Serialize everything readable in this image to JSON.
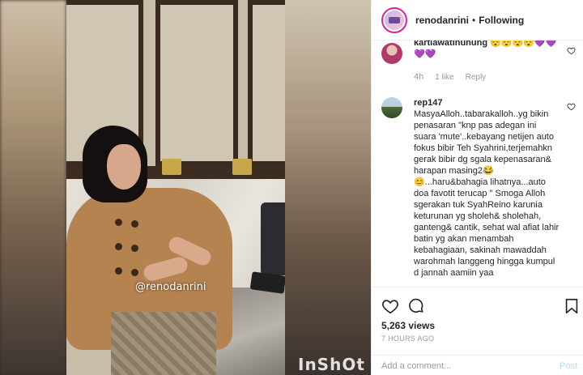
{
  "post": {
    "username": "renodanrini",
    "separator": "•",
    "follow_status": "Following",
    "video_watermark": "@renodanrini",
    "video_logo": "InShOt"
  },
  "comments": [
    {
      "username": "kartiawatinunung",
      "text": "😴😴😴😴💜💜💜💜",
      "time": "4h",
      "likes": "1 like",
      "reply_label": "Reply"
    },
    {
      "username": "rep147",
      "text": "MasyaAlloh..tabarakalloh..yg bikin penasaran \"knp pas adegan ini suara 'mute'..kebayang netijen auto fokus bibir Teh Syahrini,terjemahkn gerak bibir dg sgala kepenasaran& harapan masing2😂😊...haru&bahagia lihatnya...auto doa favotit terucap \" Smoga Alloh sgerakan tuk SyahReino karunia keturunan yg sholeh& sholehah, ganteng& cantik, sehat wal afiat lahir batin yg akan menambah kebahagiaan, sakinah mawaddah warohmah langgeng hingga kumpul d jannah aamiin yaa"
    }
  ],
  "stats": {
    "views": "5,263 views",
    "posted": "7 HOURS AGO"
  },
  "composer": {
    "placeholder": "Add a comment...",
    "post_label": "Post"
  },
  "colors": {
    "text": "#262626",
    "muted": "#999999",
    "post_disabled": "#b2dffc",
    "story_ring": "#d6249f"
  },
  "icons": [
    "heart-icon",
    "comment-icon",
    "bookmark-icon"
  ]
}
